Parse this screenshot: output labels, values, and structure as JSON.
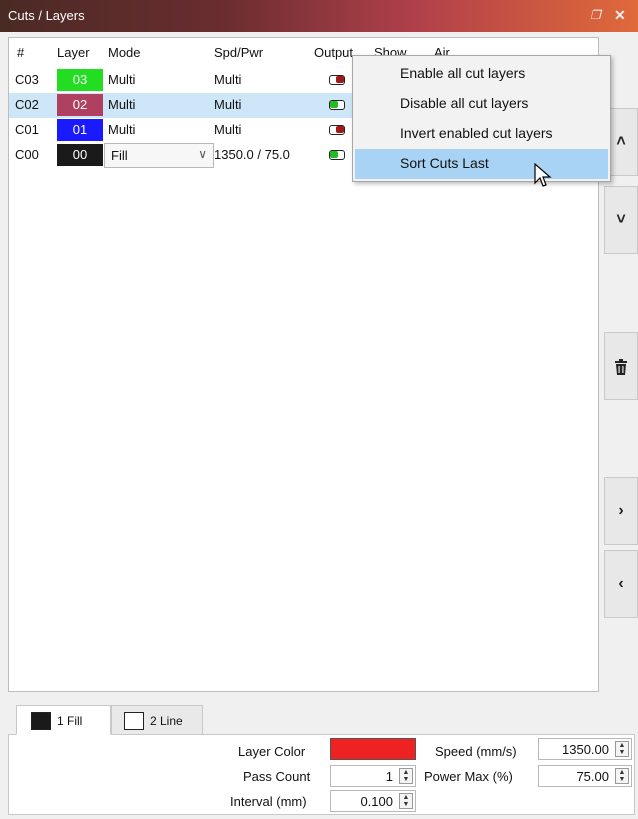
{
  "window": {
    "title": "Cuts / Layers",
    "float_icon": "restore-icon",
    "close_icon": "close-icon"
  },
  "table": {
    "headers": [
      "#",
      "Layer",
      "Mode",
      "Spd/Pwr",
      "Output",
      "Show",
      "Air"
    ],
    "rows": [
      {
        "num": "C03",
        "layer": "03",
        "layer_color": "#22dd22",
        "layer_text_color": "#ffffff",
        "mode": "Multi",
        "spdpwr": "Multi",
        "output": "off",
        "selected": false
      },
      {
        "num": "C02",
        "layer": "02",
        "layer_color": "#b04060",
        "layer_text_color": "#ffffff",
        "mode": "Multi",
        "spdpwr": "Multi",
        "output": "on",
        "selected": true
      },
      {
        "num": "C01",
        "layer": "01",
        "layer_color": "#1a1aff",
        "layer_text_color": "#ffffff",
        "mode": "Multi",
        "spdpwr": "Multi",
        "output": "off",
        "selected": false
      },
      {
        "num": "C00",
        "layer": "00",
        "layer_color": "#1a1a1a",
        "layer_text_color": "#ffffff",
        "mode": "Fill",
        "spdpwr": "1350.0 / 75.0",
        "output": "on",
        "show": "on",
        "air": "on",
        "selected": false
      }
    ]
  },
  "context_menu": {
    "items": [
      {
        "label": "Enable all cut layers",
        "hover": false
      },
      {
        "label": "Disable all cut layers",
        "hover": false
      },
      {
        "label": "Invert enabled cut layers",
        "hover": false
      },
      {
        "label": "Sort Cuts Last",
        "hover": true
      }
    ]
  },
  "side_buttons": [
    {
      "name": "move-up-button",
      "icon": "chevron-up-icon",
      "glyph": "⌃"
    },
    {
      "name": "move-down-button",
      "icon": "chevron-down-icon",
      "glyph": "⌄"
    },
    {
      "name": "delete-layer-button",
      "icon": "trash-icon",
      "glyph": "🗑"
    },
    {
      "name": "move-right-button",
      "icon": "chevron-right-icon",
      "glyph": "›"
    },
    {
      "name": "move-left-button",
      "icon": "chevron-left-icon",
      "glyph": "‹"
    }
  ],
  "tabs": [
    {
      "label": "1 Fill",
      "swatch": "#1a1a1a",
      "active": true
    },
    {
      "label": "2 Line",
      "swatch": "#ffffff",
      "active": false
    }
  ],
  "settings": {
    "layer_color_label": "Layer Color",
    "layer_color": "#ee2222",
    "pass_count_label": "Pass Count",
    "pass_count": "1",
    "interval_label": "Interval (mm)",
    "interval": "0.100",
    "speed_label": "Speed (mm/s)",
    "speed": "1350.00",
    "power_max_label": "Power Max (%)",
    "power_max": "75.00"
  }
}
